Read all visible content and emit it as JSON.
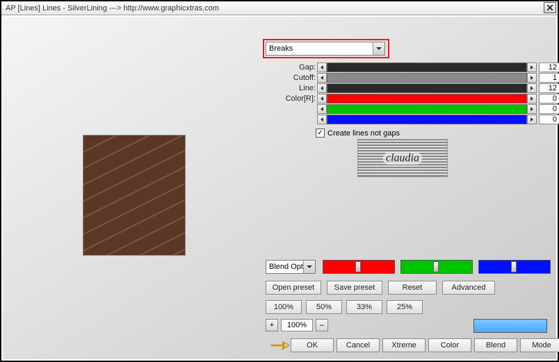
{
  "window": {
    "title": "AP [Lines]  Lines - SilverLining   ---> http://www.graphicxtras.com"
  },
  "dropdowns": {
    "breaks": "Breaks",
    "blend": "Blend Optic"
  },
  "params": {
    "gap": {
      "label": "Gap:",
      "value": "12",
      "track_color": "#2a2a2a"
    },
    "cutoff": {
      "label": "Cutoff:",
      "value": "1",
      "track_color": "#8a8a8a"
    },
    "line": {
      "label": "Line:",
      "value": "12",
      "track_color": "#2a2a2a"
    },
    "colorR": {
      "label": "Color[R]:",
      "value": "0",
      "track_color": "#ff0000"
    },
    "colorG": {
      "label": "",
      "value": "0",
      "track_color": "#00c400"
    },
    "colorB": {
      "label": "",
      "value": "0",
      "track_color": "#0010ff"
    }
  },
  "checkbox": {
    "label": "Create lines not gaps",
    "checked": true
  },
  "logo_text": "claudia",
  "rgb_sliders": {
    "r": "#ff0000",
    "g": "#00c400",
    "b": "#0010ff"
  },
  "buttons": {
    "open_preset": "Open preset",
    "save_preset": "Save preset",
    "reset": "Reset",
    "advanced": "Advanced",
    "p100": "100%",
    "p50": "50%",
    "p33": "33%",
    "p25": "25%",
    "zoom_val": "100%",
    "zoom_plus": "+",
    "zoom_minus": "–",
    "ok": "OK",
    "cancel": "Cancel",
    "xtreme": "Xtreme",
    "color": "Color",
    "blend": "Blend",
    "mode": "Mode"
  }
}
